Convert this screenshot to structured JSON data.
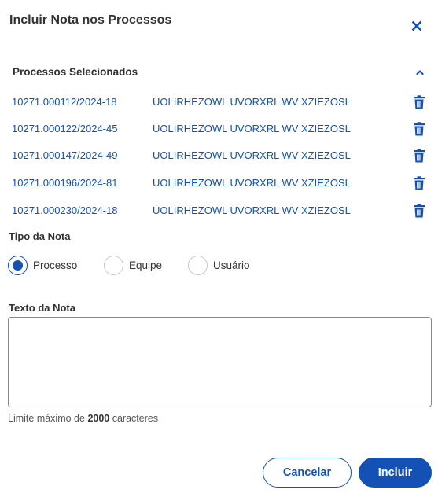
{
  "dialog": {
    "title": "Incluir Nota nos Processos",
    "close_icon": "close-icon"
  },
  "selected_processes": {
    "title": "Processos Selecionados",
    "collapse_icon": "chevron-up-icon",
    "items": [
      {
        "number": "10271.000112/2024-18",
        "name": "UOLIRHEZOWL UVORXRL WV XZIEZOSL"
      },
      {
        "number": "10271.000122/2024-45",
        "name": "UOLIRHEZOWL UVORXRL WV XZIEZOSL"
      },
      {
        "number": "10271.000147/2024-49",
        "name": "UOLIRHEZOWL UVORXRL WV XZIEZOSL"
      },
      {
        "number": "10271.000196/2024-81",
        "name": "UOLIRHEZOWL UVORXRL WV XZIEZOSL"
      },
      {
        "number": "10271.000230/2024-18",
        "name": "UOLIRHEZOWL UVORXRL WV XZIEZOSL"
      }
    ],
    "delete_icon": "trash-icon"
  },
  "note_type": {
    "label": "Tipo da Nota",
    "selected": "Processo",
    "options": [
      {
        "label": "Processo"
      },
      {
        "label": "Equipe"
      },
      {
        "label": "Usuário"
      }
    ]
  },
  "note_text": {
    "label": "Texto da Nota",
    "value": "",
    "placeholder": "",
    "limit_prefix": "Limite máximo de ",
    "limit_value": "2000",
    "limit_suffix": " caracteres"
  },
  "actions": {
    "cancel_label": "Cancelar",
    "submit_label": "Incluir"
  },
  "colors": {
    "primary": "#1351b4",
    "text": "#333333",
    "border": "#888888"
  }
}
